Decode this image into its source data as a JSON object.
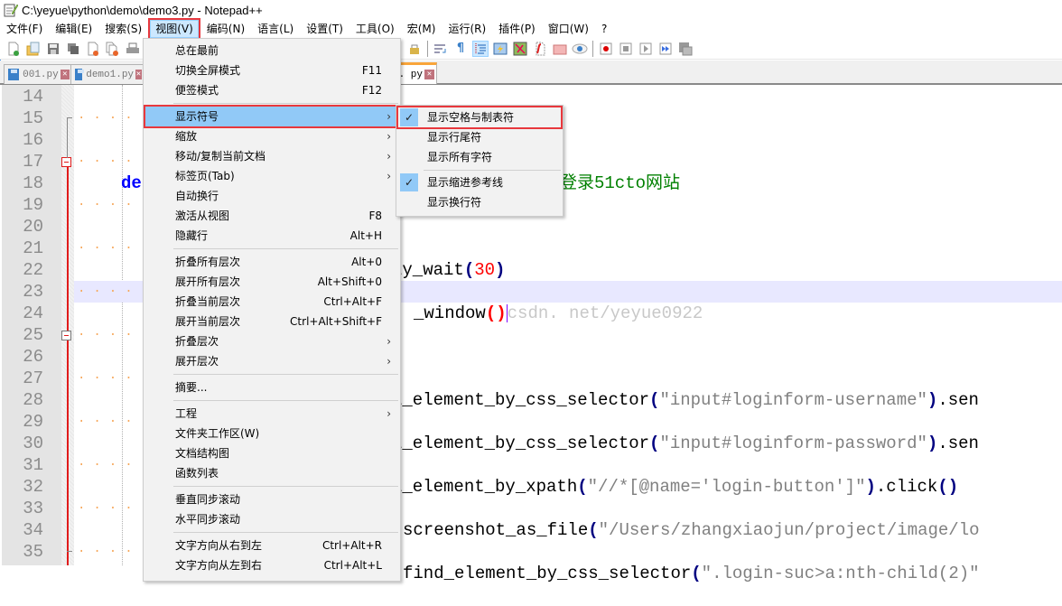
{
  "window": {
    "title": "C:\\yeyue\\python\\demo\\demo3.py - Notepad++"
  },
  "menubar": {
    "items": [
      {
        "label": "文件(F)"
      },
      {
        "label": "编辑(E)"
      },
      {
        "label": "搜索(S)"
      },
      {
        "label": "视图(V)",
        "active": true
      },
      {
        "label": "编码(N)"
      },
      {
        "label": "语言(L)"
      },
      {
        "label": "设置(T)"
      },
      {
        "label": "工具(O)"
      },
      {
        "label": "宏(M)"
      },
      {
        "label": "运行(R)"
      },
      {
        "label": "插件(P)"
      },
      {
        "label": "窗口(W)"
      },
      {
        "label": "?"
      }
    ]
  },
  "toolbar": {
    "icons": [
      "new-file-icon",
      "open-file-icon",
      "save-icon",
      "save-all-icon",
      "close-icon",
      "close-all-icon",
      "print-icon",
      "lock-icon",
      "word-wrap-icon",
      "show-all-chars-icon",
      "indent-guide-icon",
      "user-lang-icon",
      "doc-map-icon",
      "function-list-icon",
      "folder-workspace-icon",
      "monitoring-icon",
      "record-macro-icon",
      "stop-record-icon",
      "play-macro-icon",
      "run-macro-multiple-icon",
      "save-macro-icon"
    ]
  },
  "tabs": [
    {
      "label": "001.py"
    },
    {
      "label": "demo1.py"
    },
    {
      "label": ". py",
      "active": true
    }
  ],
  "editor": {
    "line_numbers": [
      "14",
      "15",
      "16",
      "17",
      "18",
      "19",
      "20",
      "21",
      "22",
      "23",
      "24",
      "25",
      "26",
      "27",
      "28",
      "29",
      "30",
      "31",
      "32",
      "33",
      "34",
      "35"
    ],
    "visible_fragments": {
      "l17_keyword": "de",
      "l17_comment": "登录51cto网站",
      "l21_code": "ly_wait",
      "l21_num": "30",
      "l23_code": "_window",
      "l23_watermark": "csdn. net/yeyue0922",
      "l27_code": "l_element_by_css_selector",
      "l27_str": "\"input#loginform-username\"",
      "l27_tail": ".sen",
      "l29_code": "l_element_by_css_selector",
      "l29_str": "\"input#loginform-password\"",
      "l29_tail": ".sen",
      "l31_code": "l_element_by_xpath",
      "l31_str": "\"//*[@name='login-button']\"",
      "l31_tail": ".click",
      "l33_code": "screenshot_as_file",
      "l33_str": "\"/Users/zhangxiaojun/project/image/lo",
      "l35_code": "find_element_by_css_selector",
      "l35_str": "\".login-suc>a:nth-child(2)\""
    }
  },
  "view_menu": {
    "items": [
      {
        "label": "总在最前",
        "shortcut": ""
      },
      {
        "label": "切换全屏模式",
        "shortcut": "F11"
      },
      {
        "label": "便签模式",
        "shortcut": "F12"
      },
      {
        "label": "显示符号",
        "submenu": true,
        "highlighted": true
      },
      {
        "label": "缩放",
        "submenu": true
      },
      {
        "label": "移动/复制当前文档",
        "submenu": true
      },
      {
        "label": "标签页(Tab)",
        "submenu": true
      },
      {
        "label": "自动换行",
        "shortcut": ""
      },
      {
        "label": "激活从视图",
        "shortcut": "F8"
      },
      {
        "label": "隐藏行",
        "shortcut": "Alt+H"
      },
      {
        "label": "折叠所有层次",
        "shortcut": "Alt+0"
      },
      {
        "label": "展开所有层次",
        "shortcut": "Alt+Shift+0"
      },
      {
        "label": "折叠当前层次",
        "shortcut": "Ctrl+Alt+F"
      },
      {
        "label": "展开当前层次",
        "shortcut": "Ctrl+Alt+Shift+F"
      },
      {
        "label": "折叠层次",
        "submenu": true
      },
      {
        "label": "展开层次",
        "submenu": true
      },
      {
        "label": "摘要...",
        "shortcut": ""
      },
      {
        "label": "工程",
        "submenu": true
      },
      {
        "label": "文件夹工作区(W)",
        "shortcut": ""
      },
      {
        "label": "文档结构图",
        "shortcut": ""
      },
      {
        "label": "函数列表",
        "shortcut": ""
      },
      {
        "label": "垂直同步滚动",
        "shortcut": ""
      },
      {
        "label": "水平同步滚动",
        "shortcut": ""
      },
      {
        "label": "文字方向从右到左",
        "shortcut": "Ctrl+Alt+R"
      },
      {
        "label": "文字方向从左到右",
        "shortcut": "Ctrl+Alt+L"
      }
    ]
  },
  "show_symbol_submenu": {
    "items": [
      {
        "label": "显示空格与制表符",
        "checked": true,
        "highlighted": true
      },
      {
        "label": "显示行尾符",
        "checked": false
      },
      {
        "label": "显示所有字符",
        "checked": false
      },
      {
        "label": "显示缩进参考线",
        "checked": true
      },
      {
        "label": "显示换行符",
        "checked": false
      }
    ]
  },
  "colors": {
    "highlight_red": "#e8383d",
    "menu_highlight": "#91c9f7",
    "tab_accent": "#f9a53b",
    "fold_marker": "#e11c1c",
    "whitespace_dots": "#f6a75a"
  }
}
